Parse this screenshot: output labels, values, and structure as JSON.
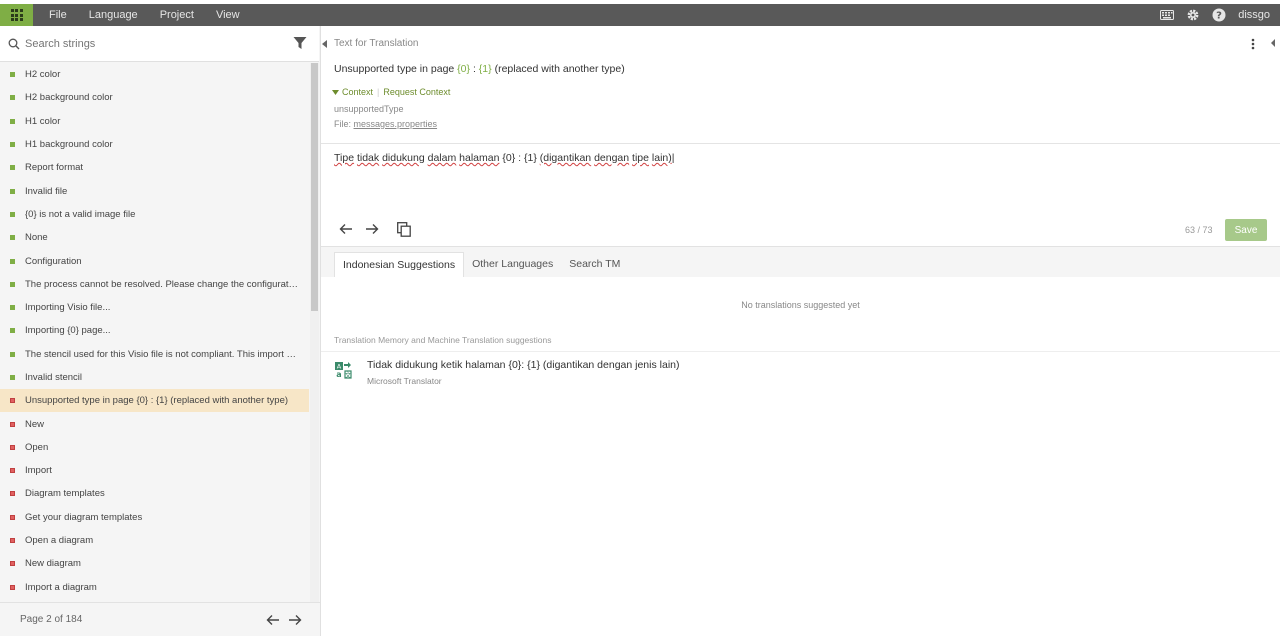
{
  "menu": [
    "File",
    "Language",
    "Project",
    "View"
  ],
  "user": "dissgo",
  "search": {
    "placeholder": "Search strings"
  },
  "strings": [
    {
      "text": "H2 color",
      "status": "done"
    },
    {
      "text": "H2 background color",
      "status": "done"
    },
    {
      "text": "H1 color",
      "status": "done"
    },
    {
      "text": "H1 background color",
      "status": "done"
    },
    {
      "text": "Report format",
      "status": "done"
    },
    {
      "text": "Invalid file",
      "status": "done"
    },
    {
      "text": "{0} is not a valid image file",
      "status": "done"
    },
    {
      "text": "None",
      "status": "done"
    },
    {
      "text": "Configuration",
      "status": "done"
    },
    {
      "text": "The process cannot be resolved. Please change the configuration t...",
      "status": "done"
    },
    {
      "text": "Importing Visio file...",
      "status": "done"
    },
    {
      "text": "Importing {0} page...",
      "status": "done"
    },
    {
      "text": "The stencil used for this Visio file is not compliant. This import only...",
      "status": "done"
    },
    {
      "text": "Invalid stencil",
      "status": "done"
    },
    {
      "text": "Unsupported type in page {0} : {1} (replaced with another type)",
      "status": "todo",
      "selected": true
    },
    {
      "text": "New",
      "status": "todo"
    },
    {
      "text": "Open",
      "status": "todo"
    },
    {
      "text": "Import",
      "status": "todo"
    },
    {
      "text": "Diagram templates",
      "status": "todo"
    },
    {
      "text": "Get your diagram templates",
      "status": "todo"
    },
    {
      "text": "Open a diagram",
      "status": "todo"
    },
    {
      "text": "New diagram",
      "status": "todo"
    },
    {
      "text": "Import a diagram",
      "status": "todo"
    }
  ],
  "pager": {
    "label": "Page 2 of 184"
  },
  "editor": {
    "section_title": "Text for Translation",
    "source_parts": [
      "Unsupported type in page ",
      "{0}",
      " : ",
      "{1}",
      " (replaced with another type)"
    ],
    "context_label": "Context",
    "request_context_label": "Request Context",
    "key": "unsupportedType",
    "file_prefix": "File: ",
    "file_name": "messages.properties",
    "translation": "Tipe tidak didukung dalam halaman {0} : {1} (digantikan dengan tipe lain)",
    "count": "63 / 73",
    "save_label": "Save"
  },
  "tabs": [
    "Indonesian Suggestions",
    "Other Languages",
    "Search TM"
  ],
  "no_suggestions": "No translations suggested yet",
  "tm": {
    "label": "Translation Memory and Machine Translation suggestions",
    "suggestion": "Tidak didukung ketik halaman {0}: {1} (digantikan dengan jenis lain)",
    "source": "Microsoft Translator"
  },
  "colors": {
    "accent": "#7fae45",
    "topbar": "#595959",
    "selected_row": "#f7e6c7",
    "todo": "#e06060"
  }
}
